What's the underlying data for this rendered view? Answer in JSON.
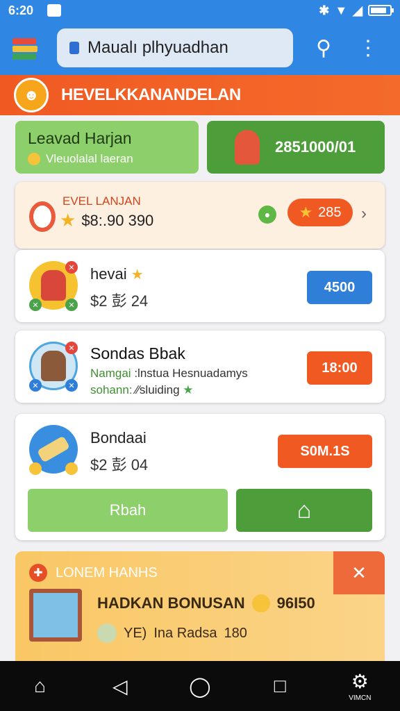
{
  "status_bar": {
    "time": "6:20",
    "battery_percent": 85
  },
  "app_bar": {
    "search_value": "Maualı plhyuadhan"
  },
  "banner": {
    "title": "HEVELKKANANDELAN"
  },
  "top_cards": {
    "left_title": "Leavad Harjan",
    "left_subtitle": "Vleuolalal laeran",
    "right_value": "2851000/01"
  },
  "level_card": {
    "title": "EVEL LANJAN",
    "amount": "$8:.90 390",
    "star_count": "285"
  },
  "items": [
    {
      "title": "hevai",
      "subtitle": "$2 彭 24",
      "price": "4500",
      "color": "#2f7fd8"
    },
    {
      "title": "Sondas Bbak",
      "line1_label": "Namgai",
      "line1_value": ":lnstua Hesnuadamys",
      "line2_label": "sohann:",
      "line2_value": "∕∕sluiding",
      "price": "18:00",
      "color": "#f05a22"
    },
    {
      "title": "Bondaai",
      "subtitle": "$2 彭 04",
      "price": "S0M.1S",
      "color": "#f05a22",
      "action_label": "Rbah"
    }
  ],
  "promo": {
    "title": "LONEM HANHS",
    "headline": "HADKAN BONUSAN",
    "headline_value": "96I50",
    "sub_left": "YE)",
    "sub_text": "Ina Radsa",
    "sub_value": "180"
  },
  "nav": {
    "settings_caption": "VIMCN"
  }
}
